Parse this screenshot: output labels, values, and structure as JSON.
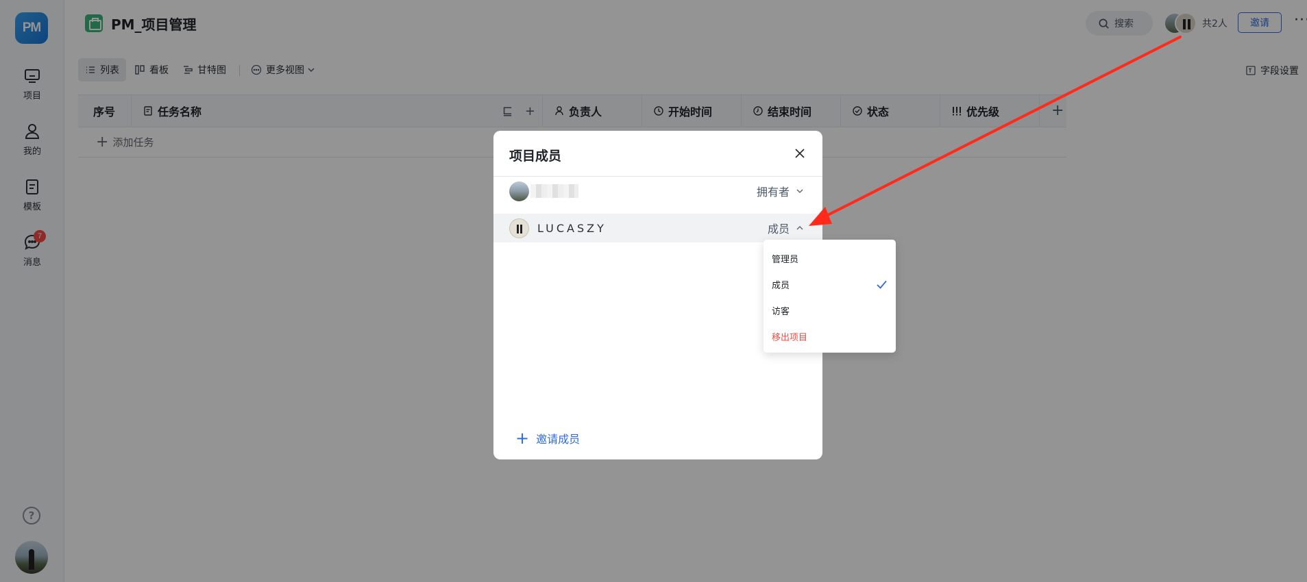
{
  "sidebar": {
    "logo": "PM",
    "items": [
      {
        "label": "项目",
        "icon": "monitor-icon"
      },
      {
        "label": "我的",
        "icon": "person-icon"
      },
      {
        "label": "模板",
        "icon": "template-icon"
      },
      {
        "label": "消息",
        "icon": "chat-icon",
        "badge": "7"
      }
    ],
    "help": "?"
  },
  "header": {
    "project_title": "PM_项目管理",
    "search_label": "搜索",
    "member_count": "共2人",
    "invite_label": "邀请",
    "more_label": "···"
  },
  "view_bar": {
    "tabs": [
      {
        "label": "列表",
        "icon": "list-icon",
        "active": true
      },
      {
        "label": "看板",
        "icon": "kanban-icon",
        "active": false
      },
      {
        "label": "甘特图",
        "icon": "gantt-icon",
        "active": false
      },
      {
        "label": "更多视图",
        "icon": "more-views-icon",
        "active": false
      }
    ],
    "field_settings": "字段设置"
  },
  "table": {
    "columns": [
      {
        "label": "序号",
        "icon": ""
      },
      {
        "label": "任务名称",
        "icon": "doc-icon"
      },
      {
        "label": "负责人",
        "icon": "person-icon"
      },
      {
        "label": "开始时间",
        "icon": "clock-icon"
      },
      {
        "label": "结束时间",
        "icon": "clock-icon"
      },
      {
        "label": "状态",
        "icon": "check-circle-icon"
      },
      {
        "label": "优先级",
        "icon": "priority-icon"
      }
    ],
    "add_task_label": "添加任务"
  },
  "modal": {
    "title": "项目成员",
    "members": [
      {
        "name": "",
        "role": "拥有者",
        "expanded": false
      },
      {
        "name": "LUCASZY",
        "role": "成员",
        "expanded": true
      }
    ],
    "invite_label": "邀请成员"
  },
  "role_dropdown": {
    "options": [
      {
        "label": "管理员",
        "selected": false,
        "danger": false
      },
      {
        "label": "成员",
        "selected": true,
        "danger": false
      },
      {
        "label": "访客",
        "selected": false,
        "danger": false
      },
      {
        "label": "移出项目",
        "selected": false,
        "danger": true
      }
    ]
  },
  "colors": {
    "accent": "#2f6bdf",
    "danger": "#f54a45",
    "annotation_arrow": "#ff2a1a",
    "project_icon": "#3bb57a"
  }
}
